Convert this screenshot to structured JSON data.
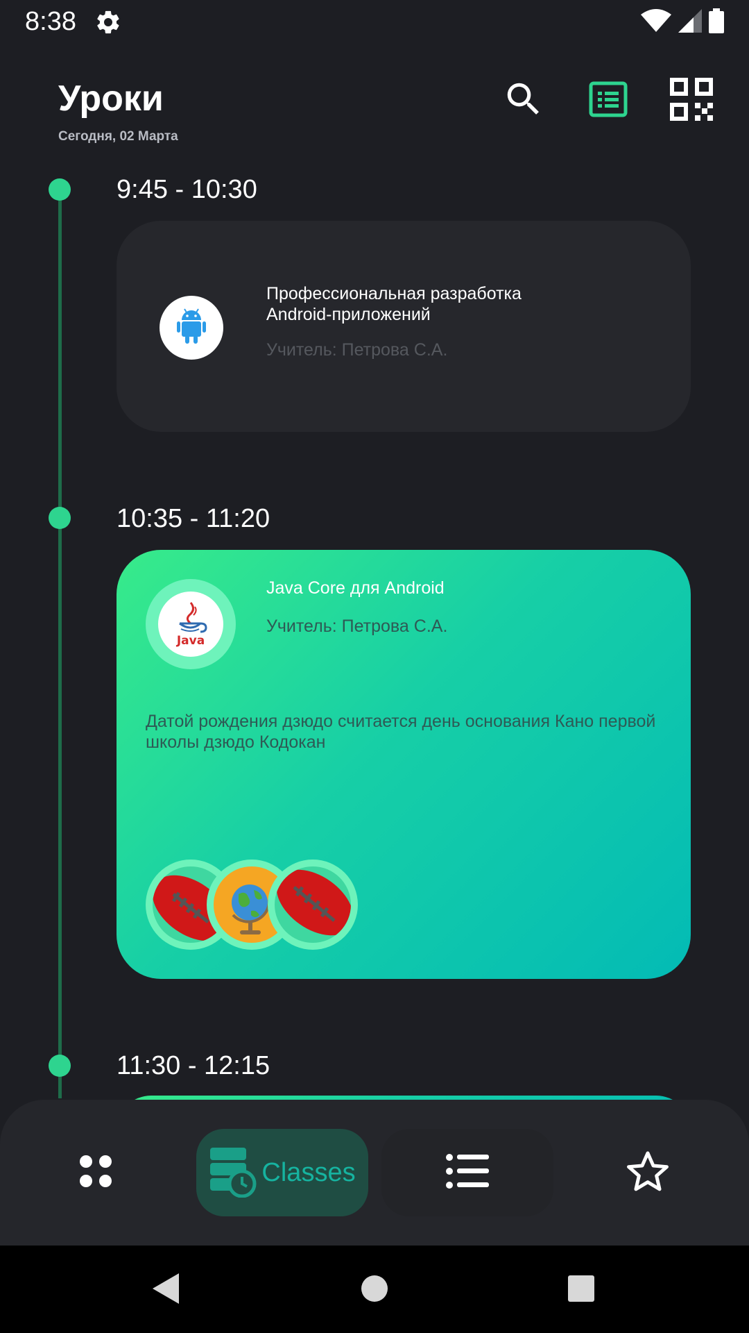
{
  "status": {
    "time": "8:38"
  },
  "header": {
    "title": "Уроки",
    "subtitle": "Сегодня, 02 Марта"
  },
  "lessons": [
    {
      "time": "9:45 - 10:30",
      "title": "Профессиональная разработка Android-приложений",
      "teacher": "Учитель: Петрова С.А.",
      "icon": "android-icon"
    },
    {
      "time": "10:35 - 11:20",
      "title": "Java Core для Android",
      "teacher": "Учитель: Петрова С.А.",
      "description": "Датой рождения дзюдо считается день основания Кано первой школы дзюдо Кодокан",
      "icon": "java-icon",
      "java_text": "Java",
      "attachments": [
        "football-icon",
        "globe-icon",
        "football-icon"
      ]
    },
    {
      "time": "11:30 - 12:15"
    }
  ],
  "bottom_nav": {
    "items": [
      {
        "name": "dashboard",
        "icon": "dots-grid-icon"
      },
      {
        "name": "classes",
        "icon": "classes-icon",
        "label": "Classes",
        "active": true
      },
      {
        "name": "list",
        "icon": "list-icon"
      },
      {
        "name": "favorites",
        "icon": "star-icon"
      }
    ]
  },
  "colors": {
    "background": "#1d1e23",
    "accent": "#2ed48f",
    "card_dark": "#26272c",
    "gradient_start": "#38eb8a",
    "gradient_end": "#03bbb5"
  }
}
